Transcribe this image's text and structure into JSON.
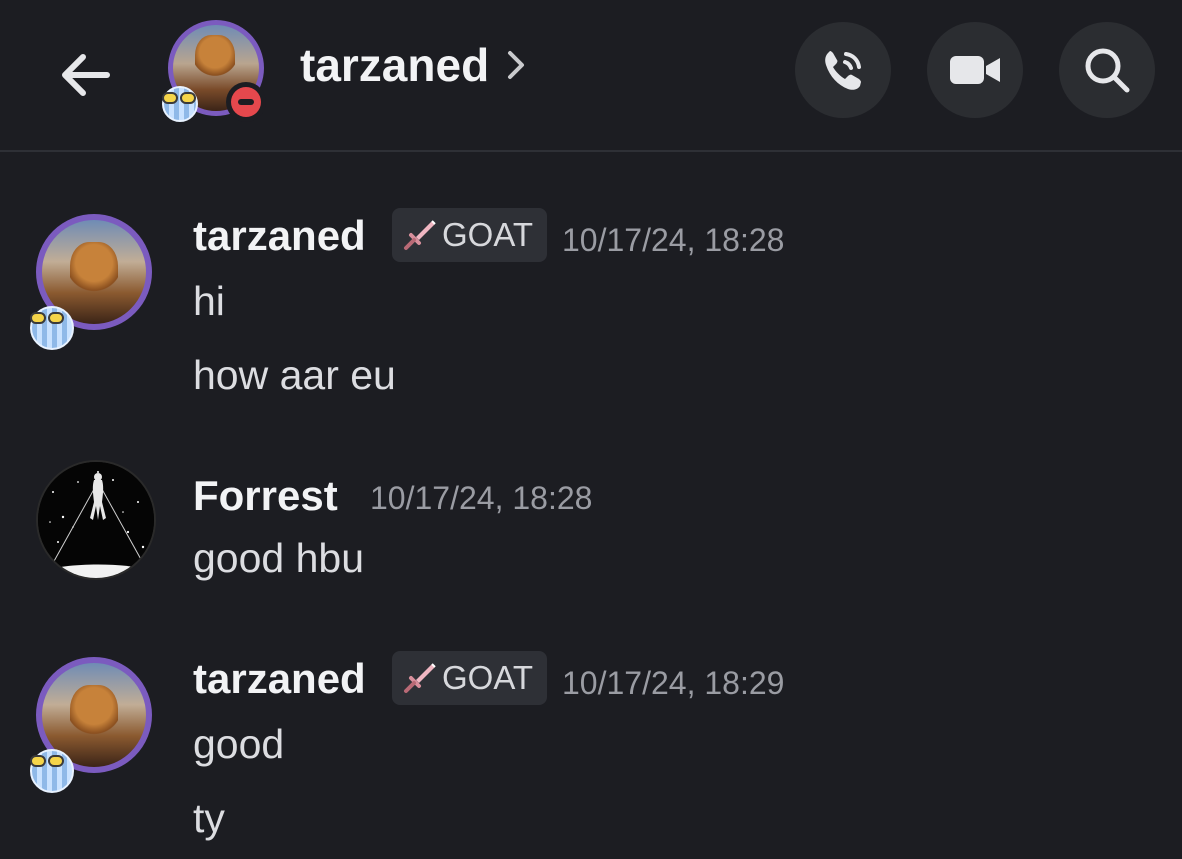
{
  "header": {
    "title": "tarzaned",
    "status": "do-not-disturb",
    "icons": [
      "back-arrow-icon",
      "chevron-right-icon",
      "voice-call-icon",
      "video-camera-icon",
      "search-icon"
    ]
  },
  "messages": [
    {
      "author": "tarzaned",
      "badge": "GOAT",
      "badge_icon": "sword-icon",
      "timestamp": "10/17/24, 18:28",
      "lines": [
        "hi",
        "how aar eu"
      ]
    },
    {
      "author": "Forrest",
      "timestamp": "10/17/24, 18:28",
      "lines": [
        "good hbu"
      ]
    },
    {
      "author": "tarzaned",
      "badge": "GOAT",
      "badge_icon": "sword-icon",
      "timestamp": "10/17/24, 18:29",
      "lines": [
        "good",
        "ty"
      ]
    }
  ],
  "colors": {
    "background": "#1c1d22",
    "button_bg": "#2b2d31",
    "dnd_red": "#e5484d",
    "avatar_ring": "#7b5bbf",
    "timestamp": "#9a9ca3"
  }
}
